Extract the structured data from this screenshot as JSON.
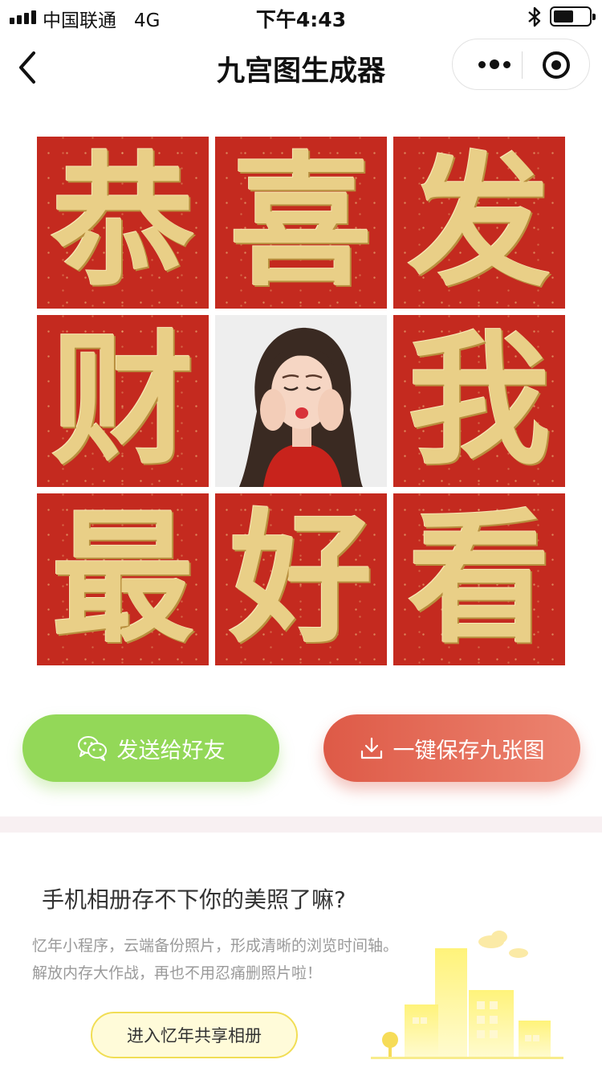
{
  "status_bar": {
    "carrier": "中国联通",
    "network": "4G",
    "time": "下午4:43"
  },
  "nav": {
    "title": "九宫图生成器",
    "back_icon": "chevron-left-icon",
    "more_icon": "more-dots-icon",
    "close_icon": "target-circle-icon"
  },
  "grid": {
    "tiles": [
      {
        "char": "恭"
      },
      {
        "char": "喜"
      },
      {
        "char": "发"
      },
      {
        "char": "财"
      },
      {
        "char": ""
      },
      {
        "char": "我"
      },
      {
        "char": "最"
      },
      {
        "char": "好"
      },
      {
        "char": "看"
      }
    ],
    "tile_color": "#c42a1f",
    "text_color": "#e9cf87"
  },
  "actions": {
    "share_label": "发送给好友",
    "save_label": "一键保存九张图",
    "share_color": "#93d858",
    "save_color": "#de5a47"
  },
  "promo": {
    "title": "手机相册存不下你的美照了嘛?",
    "desc_line1": "忆年小程序，云端备份照片，形成清晰的浏览时间轴。",
    "desc_line2": "解放内存大作战，再也不用忍痛删照片啦！",
    "button_label": "进入忆年共享相册"
  }
}
